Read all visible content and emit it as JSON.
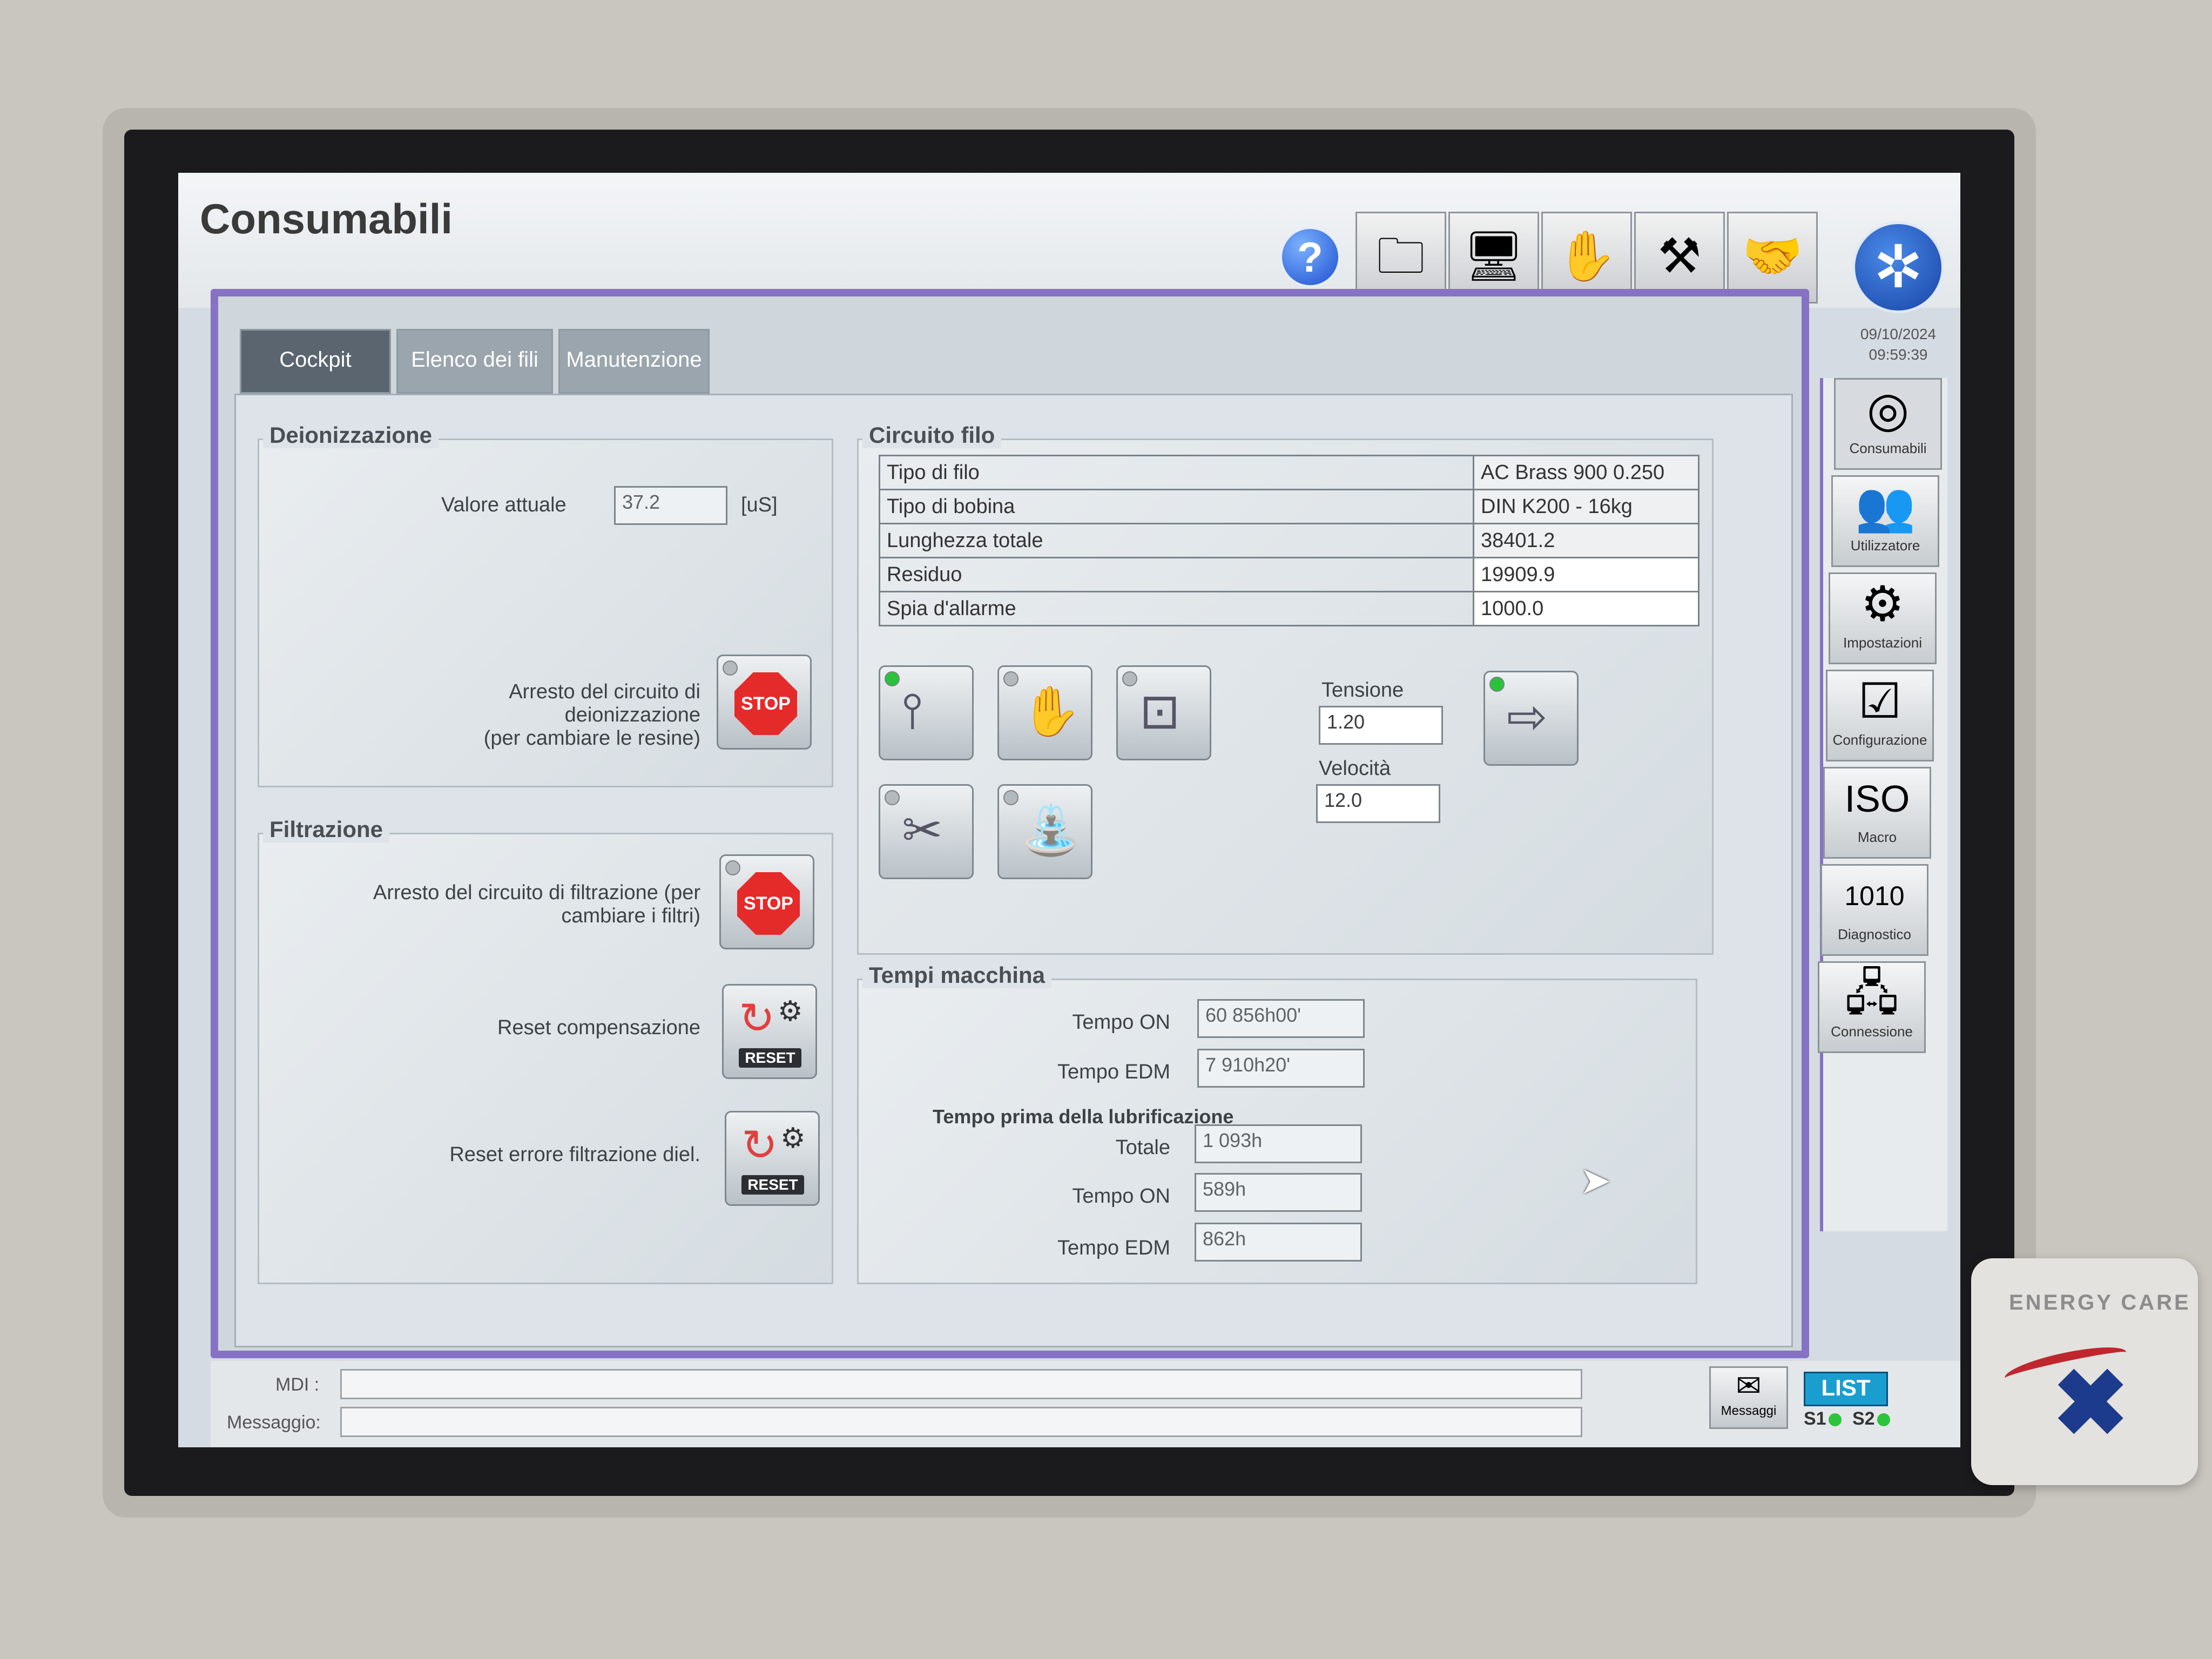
{
  "window": {
    "title": "Consumabili",
    "date": "09/10/2024",
    "time": "09:59:39"
  },
  "tabs": [
    {
      "label": "Cockpit",
      "active": true
    },
    {
      "label": "Elenco dei fili",
      "active": false
    },
    {
      "label": "Manutenzione",
      "active": false
    }
  ],
  "toolbar": {
    "buttons": [
      {
        "icon": "folder-icon",
        "color": "#1fb0d8"
      },
      {
        "icon": "operator-screen-icon",
        "color": "#22c13a"
      },
      {
        "icon": "hand-settings-icon",
        "color": "#e8c43a"
      },
      {
        "icon": "machine-tool-icon",
        "color": "#e06a2a"
      },
      {
        "icon": "service-hand-icon",
        "color": ""
      }
    ]
  },
  "deionizzazione": {
    "title": "Deionizzazione",
    "valore_label": "Valore attuale",
    "valore": "37.2",
    "unit": "[uS]",
    "arresto_line1": "Arresto del circuito di deionizzazione",
    "arresto_line2": "(per cambiare le resine)",
    "stop_label": "STOP"
  },
  "filtrazione": {
    "title": "Filtrazione",
    "arresto_line1": "Arresto del circuito di filtrazione (per",
    "arresto_line2": "cambiare i filtri)",
    "stop_label": "STOP",
    "reset_comp_label": "Reset compensazione",
    "reset_err_label": "Reset errore filtrazione diel.",
    "reset_btn": "RESET"
  },
  "circuito_filo": {
    "title": "Circuito filo",
    "rows": [
      {
        "label": "Tipo di filo",
        "value": "AC Brass 900 0.250"
      },
      {
        "label": "Tipo di bobina",
        "value": "DIN K200 - 16kg"
      },
      {
        "label": "Lunghezza totale",
        "value": "38401.2"
      },
      {
        "label": "Residuo",
        "value": "19909.9"
      },
      {
        "label": "Spia d'allarme",
        "value": "1000.0"
      }
    ],
    "tensione_label": "Tensione",
    "tensione": "1.20",
    "velocita_label": "Velocità",
    "velocita": "12.0"
  },
  "tempi": {
    "title": "Tempi macchina",
    "tempo_on_label": "Tempo ON",
    "tempo_on": "60 856h00'",
    "tempo_edm_label": "Tempo EDM",
    "tempo_edm": "7 910h20'",
    "lub_title": "Tempo prima della lubrificazione",
    "totale_label": "Totale",
    "totale": "1 093h",
    "lub_on_label": "Tempo ON",
    "lub_on": "589h",
    "lub_edm_label": "Tempo EDM",
    "lub_edm": "862h"
  },
  "side_menu": [
    {
      "label": "Consumabili",
      "icon": "wire-spool-icon"
    },
    {
      "label": "Utilizzatore",
      "icon": "users-icon"
    },
    {
      "label": "Impostazioni",
      "icon": "settings-icon"
    },
    {
      "label": "Configurazione",
      "icon": "configuration-icon"
    },
    {
      "label": "Macro",
      "icon": "iso-macro-icon"
    },
    {
      "label": "Diagnostico",
      "icon": "diagnostic-icon"
    },
    {
      "label": "Connessione",
      "icon": "connection-icon"
    }
  ],
  "consumabili_percent": "%",
  "bottom": {
    "mdi_label": "MDI :",
    "messaggio_label": "Messaggio:",
    "messaggi_btn": "Messaggi",
    "list_btn": "LIST",
    "s1": "S1",
    "s2": "S2"
  },
  "energy_care": "ENERGY CARE"
}
